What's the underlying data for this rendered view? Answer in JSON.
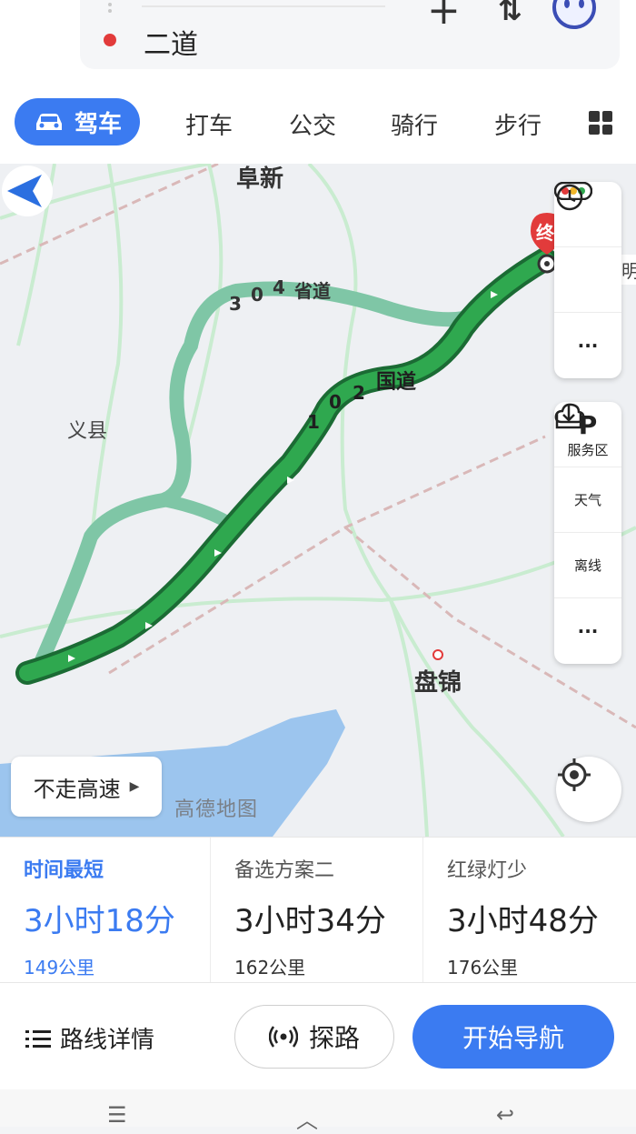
{
  "search": {
    "destination": "二道"
  },
  "modes": {
    "drive": "驾车",
    "taxi": "打车",
    "bus": "公交",
    "bike": "骑行",
    "walk": "步行"
  },
  "map": {
    "labels": {
      "fuxin": "阜新",
      "yixian": "义县",
      "panjin": "盘锦",
      "ming": "明",
      "watermark": "高德地图"
    },
    "road_304": [
      "3",
      "0",
      "4",
      "省道"
    ],
    "road_102": [
      "1",
      "0",
      "2",
      "国道"
    ],
    "end_marker": "终",
    "no_highway": "不走高速",
    "side": {
      "service": "服务区",
      "weather": "天气",
      "offline": "离线",
      "more": "···"
    }
  },
  "routes": [
    {
      "tag": "时间最短",
      "time": "3小时18分",
      "distance": "149公里"
    },
    {
      "tag": "备选方案二",
      "time": "3小时34分",
      "distance": "162公里"
    },
    {
      "tag": "红绿灯少",
      "time": "3小时48分",
      "distance": "176公里"
    }
  ],
  "actions": {
    "details": "路线详情",
    "explore": "探路",
    "start": "开始导航"
  },
  "colors": {
    "accent": "#3b7bf1",
    "route": "#2fa84f",
    "alt_route": "#7fc6a6",
    "marker": "#e23b3b"
  },
  "sys": {
    "menu": "☰",
    "home": "︿",
    "back": "↩"
  }
}
